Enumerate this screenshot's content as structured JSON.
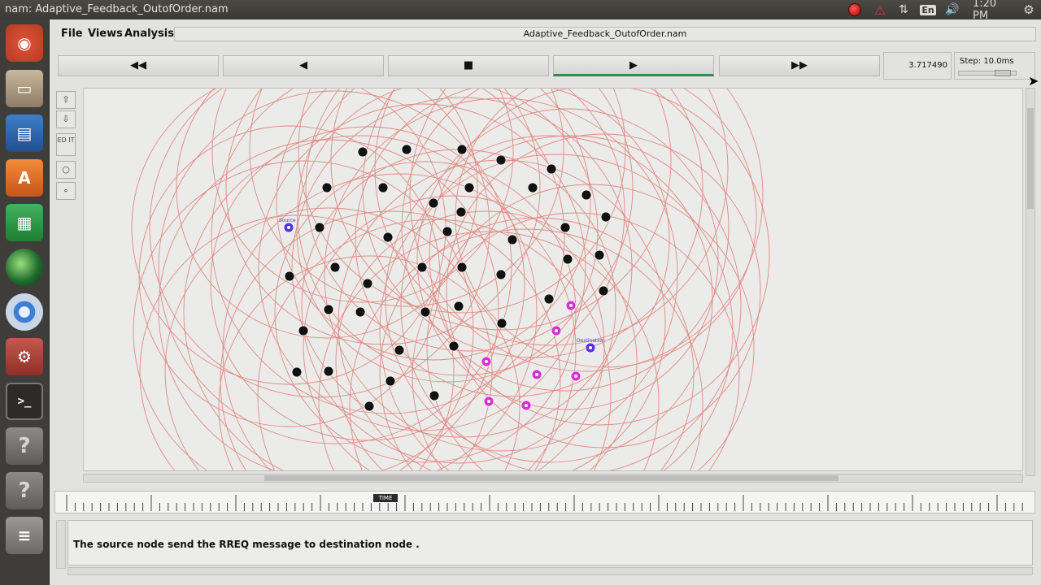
{
  "window": {
    "title": "nam: Adaptive_Feedback_OutofOrder.nam"
  },
  "tray": {
    "lang": "En",
    "clock": "1:20 PM"
  },
  "launcher": {
    "items": [
      "ubuntu-logo-icon",
      "files-icon",
      "writer-icon",
      "software-center-icon",
      "calc-icon",
      "globe-icon",
      "chromium-icon",
      "settings-icon",
      "terminal-icon",
      "help-icon",
      "help-icon",
      "trash-icon"
    ]
  },
  "menu": {
    "file": "File",
    "views": "Views",
    "analysis": "Analysis"
  },
  "file_name": "Adaptive_Feedback_OutofOrder.nam",
  "controls": {
    "rewind": "◀◀",
    "back": "◀",
    "stop": "■",
    "play": "▶",
    "fast_forward": "▶▶",
    "time": "3.717490",
    "step": "Step: 10.0ms"
  },
  "tools": {
    "edit": "ED IT"
  },
  "timeline": {
    "marker": "TIME"
  },
  "annotation": {
    "text": "The source node send the RREQ message to destination node ."
  },
  "colors": {
    "range_circle": "#e08a82",
    "node": "#111111",
    "highlight_node": "#d630d6",
    "source_node": "#5533e0",
    "label_green": "#4fbf4f"
  },
  "network": {
    "nodes": [
      [
        445,
        186,
        "black"
      ],
      [
        499,
        183,
        "black"
      ],
      [
        567,
        183,
        "black"
      ],
      [
        615,
        196,
        "black"
      ],
      [
        677,
        207,
        "black"
      ],
      [
        401,
        230,
        "black"
      ],
      [
        470,
        230,
        "black"
      ],
      [
        576,
        230,
        "black"
      ],
      [
        654,
        230,
        "black"
      ],
      [
        720,
        239,
        "black"
      ],
      [
        744,
        266,
        "black"
      ],
      [
        532,
        249,
        "black"
      ],
      [
        566,
        260,
        "black"
      ],
      [
        392,
        279,
        "black"
      ],
      [
        476,
        291,
        "black"
      ],
      [
        549,
        284,
        "black"
      ],
      [
        629,
        294,
        "black"
      ],
      [
        694,
        279,
        "black"
      ],
      [
        736,
        313,
        "black"
      ],
      [
        411,
        328,
        "black"
      ],
      [
        355,
        339,
        "black"
      ],
      [
        451,
        348,
        "black"
      ],
      [
        518,
        328,
        "black"
      ],
      [
        567,
        328,
        "black"
      ],
      [
        615,
        337,
        "black"
      ],
      [
        697,
        318,
        "black"
      ],
      [
        741,
        357,
        "black"
      ],
      [
        674,
        367,
        "black"
      ],
      [
        403,
        380,
        "black"
      ],
      [
        442,
        383,
        "black"
      ],
      [
        522,
        383,
        "black"
      ],
      [
        563,
        376,
        "black"
      ],
      [
        616,
        397,
        "black"
      ],
      [
        372,
        406,
        "black"
      ],
      [
        490,
        430,
        "black"
      ],
      [
        557,
        425,
        "black"
      ],
      [
        364,
        457,
        "black"
      ],
      [
        403,
        456,
        "black"
      ],
      [
        479,
        468,
        "black"
      ],
      [
        533,
        486,
        "black"
      ],
      [
        453,
        499,
        "black"
      ],
      [
        354,
        279,
        "source"
      ],
      [
        725,
        427,
        "source"
      ],
      [
        701,
        375,
        "pink"
      ],
      [
        683,
        406,
        "pink"
      ],
      [
        597,
        444,
        "pink"
      ],
      [
        659,
        460,
        "pink"
      ],
      [
        707,
        462,
        "pink"
      ],
      [
        600,
        493,
        "pink"
      ],
      [
        646,
        498,
        "pink"
      ]
    ],
    "source_label": "Source",
    "destination_label": "Destination"
  }
}
